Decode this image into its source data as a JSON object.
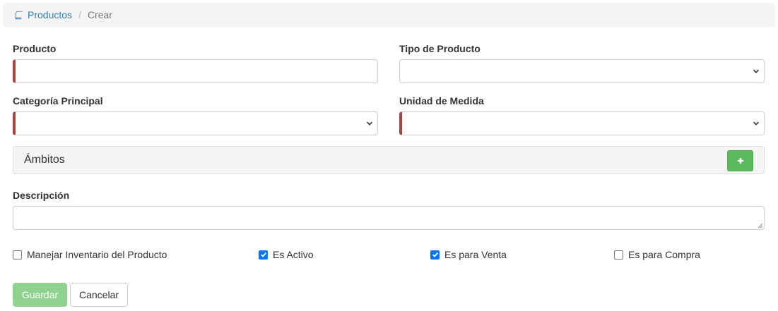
{
  "breadcrumb": {
    "icon": "book-icon",
    "link_label": "Productos",
    "separator": "/",
    "current_label": "Crear"
  },
  "form": {
    "producto": {
      "label": "Producto",
      "value": ""
    },
    "tipo_producto": {
      "label": "Tipo de Producto",
      "value": ""
    },
    "categoria_principal": {
      "label": "Categoría Principal",
      "value": ""
    },
    "unidad_medida": {
      "label": "Unidad de Medida",
      "value": ""
    },
    "ambitos": {
      "title": "Ámbitos",
      "add_icon": "plus-icon"
    },
    "descripcion": {
      "label": "Descripción",
      "value": ""
    }
  },
  "checkboxes": {
    "manejar_inventario": {
      "label": "Manejar Inventario del Producto",
      "checked": false
    },
    "es_activo": {
      "label": "Es Activo",
      "checked": true
    },
    "es_para_venta": {
      "label": "Es para Venta",
      "checked": true
    },
    "es_para_compra": {
      "label": "Es para Compra",
      "checked": false
    }
  },
  "actions": {
    "save_label": "Guardar",
    "cancel_label": "Cancelar"
  },
  "colors": {
    "link": "#337ab7",
    "required_marker": "#a94442",
    "add_button": "#5cb85c",
    "save_button_disabled": "#8fd18f",
    "checkbox_checked": "#0075ff"
  }
}
